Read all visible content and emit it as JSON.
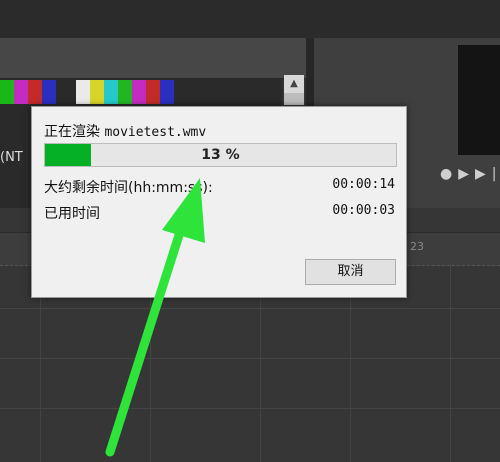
{
  "background": {
    "source_monitor_label": "(NT",
    "timeline_tick": "23",
    "transport_icons": [
      "record-icon",
      "play-icon",
      "step-forward-icon"
    ]
  },
  "dialog": {
    "title_prefix": "正在渲染",
    "filename": "movietest.wmv",
    "progress_percent": 13,
    "progress_label": "13 %",
    "remaining_label": "大约剩余时间(hh:mm:ss):",
    "remaining_value": "00:00:14",
    "elapsed_label": "已用时间",
    "elapsed_value": "00:00:03",
    "cancel_label": "取消"
  },
  "colors": {
    "progress_fill": "#06b025",
    "annotation_arrow": "#2ee33a",
    "dialog_bg": "#f0f0f0"
  }
}
